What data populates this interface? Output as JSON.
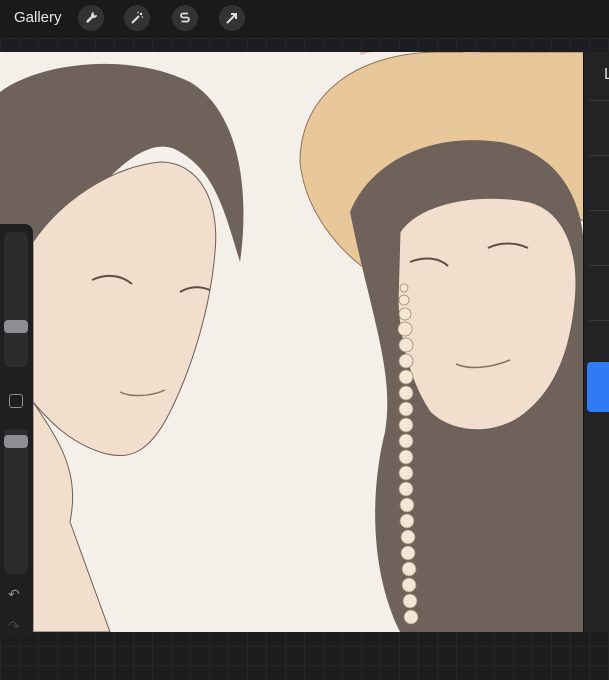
{
  "toolbar": {
    "gallery_label": "Gallery",
    "tools": [
      {
        "icon": "wrench-icon"
      },
      {
        "icon": "magic-wand-icon"
      },
      {
        "icon": "selection-s-icon"
      },
      {
        "icon": "transform-arrow-icon"
      }
    ]
  },
  "layers_panel": {
    "title_fragment": "L"
  },
  "sidebar": {
    "brush_size_level": 0.24,
    "opacity_level": 0.05,
    "undo_icon": "undo-icon",
    "redo_icon": "redo-icon"
  },
  "colors": {
    "canvas": "#f4efe9",
    "skin": "#f2decc",
    "hair": "#6e625a",
    "hat": "#e8c89a",
    "accent_blue": "#2f7bf6"
  }
}
